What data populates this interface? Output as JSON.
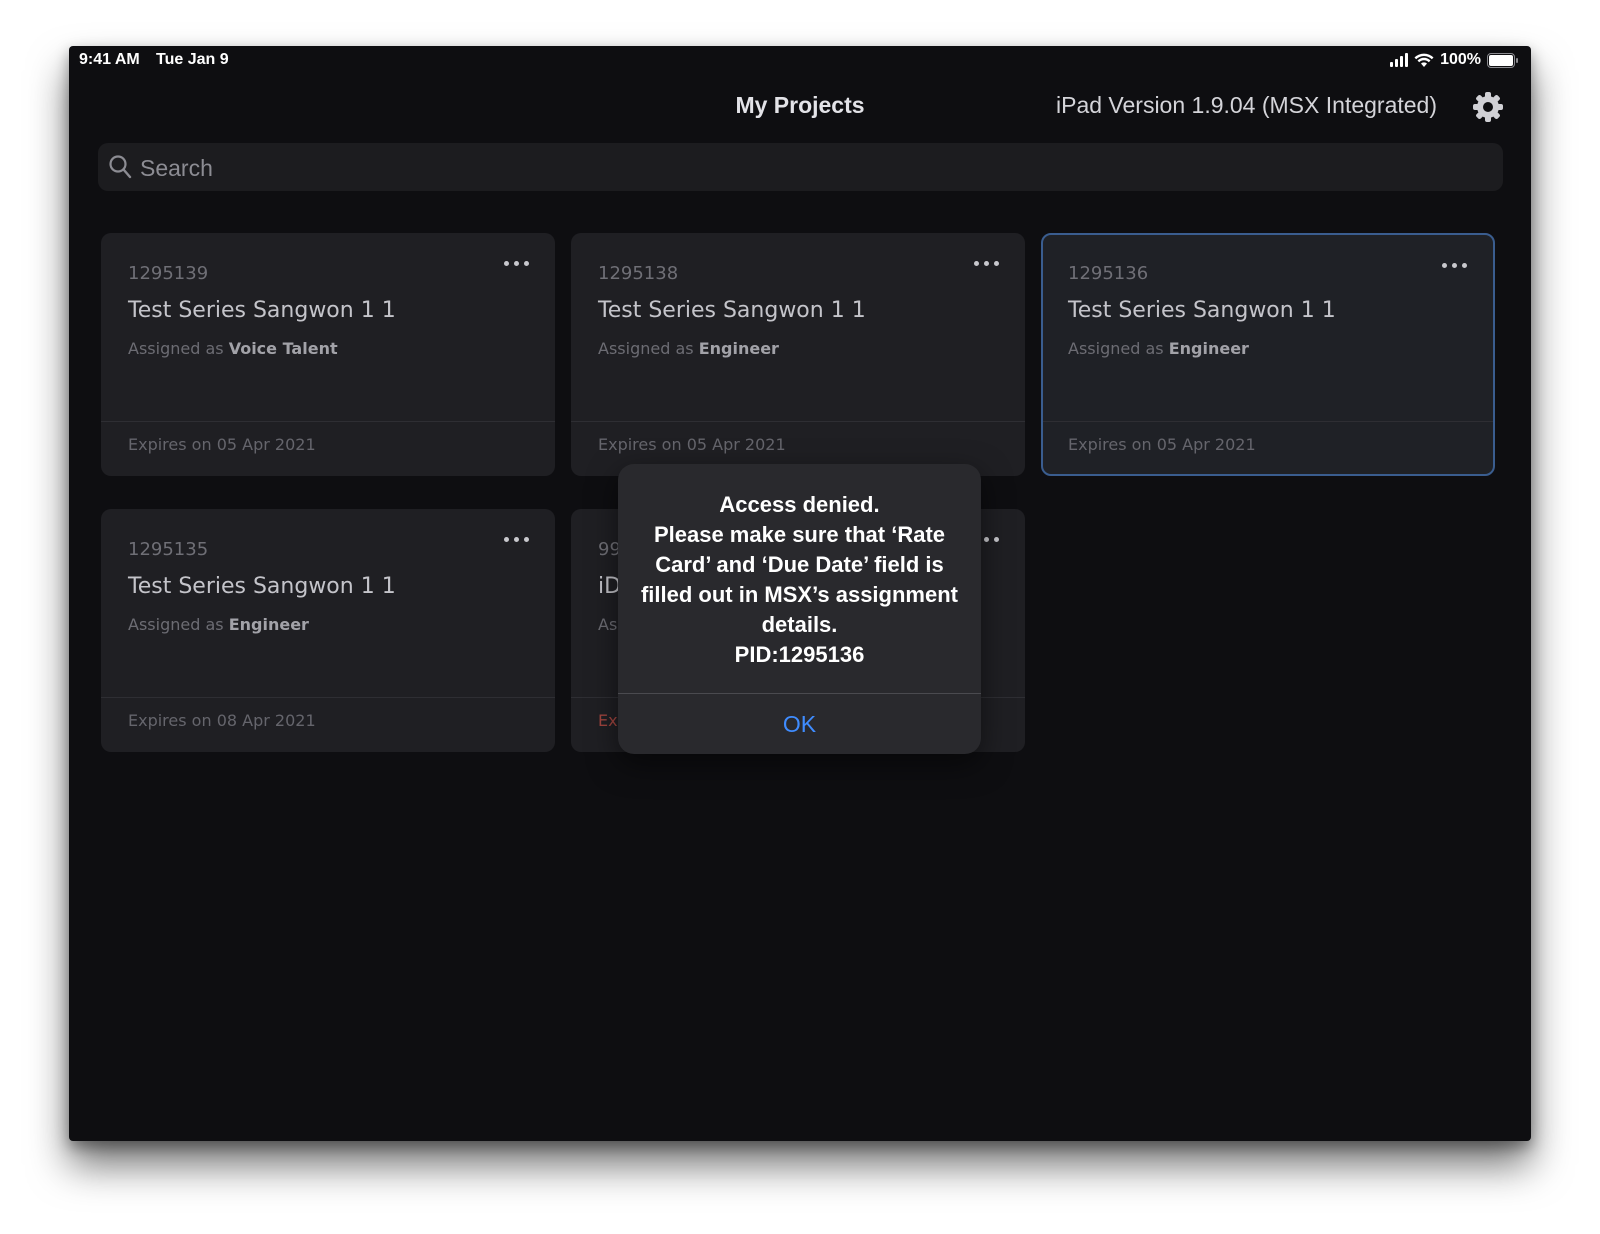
{
  "status_bar": {
    "time": "9:41 AM",
    "date": "Tue Jan 9",
    "battery": "100%"
  },
  "header": {
    "title": "My Projects",
    "version": "iPad Version 1.9.04 (MSX Integrated)"
  },
  "search": {
    "placeholder": "Search",
    "value": ""
  },
  "cards": [
    {
      "id": "1295139",
      "title": "Test Series Sangwon 1 1",
      "assigned_prefix": "Assigned as",
      "role": "Voice Talent",
      "expiry": "Expires on 05 Apr 2021"
    },
    {
      "id": "1295138",
      "title": "Test Series Sangwon 1 1",
      "assigned_prefix": "Assigned as",
      "role": "Engineer",
      "expiry": "Expires on 05 Apr 2021"
    },
    {
      "id": "1295136",
      "title": "Test Series Sangwon 1 1",
      "assigned_prefix": "Assigned as",
      "role": "Engineer",
      "expiry": "Expires on 05 Apr 2021",
      "selected": true
    },
    {
      "id": "1295135",
      "title": "Test Series Sangwon 1 1",
      "assigned_prefix": "Assigned as",
      "role": "Engineer",
      "expiry": "Expires on 08 Apr 2021"
    },
    {
      "id": "99",
      "title": "iD",
      "assigned_prefix": "As",
      "role": "",
      "expiry": "Ex",
      "expired": true
    }
  ],
  "alert": {
    "message": "Access denied.\nPlease make sure that ‘Rate Card’ and ‘Due Date’ field is filled out in MSX’s assignment details.\nPID:1295136",
    "ok_label": "OK"
  },
  "colors": {
    "accent": "#3f8cff",
    "selected_border": "#3a5d8f",
    "expired_text": "#a0443e"
  }
}
